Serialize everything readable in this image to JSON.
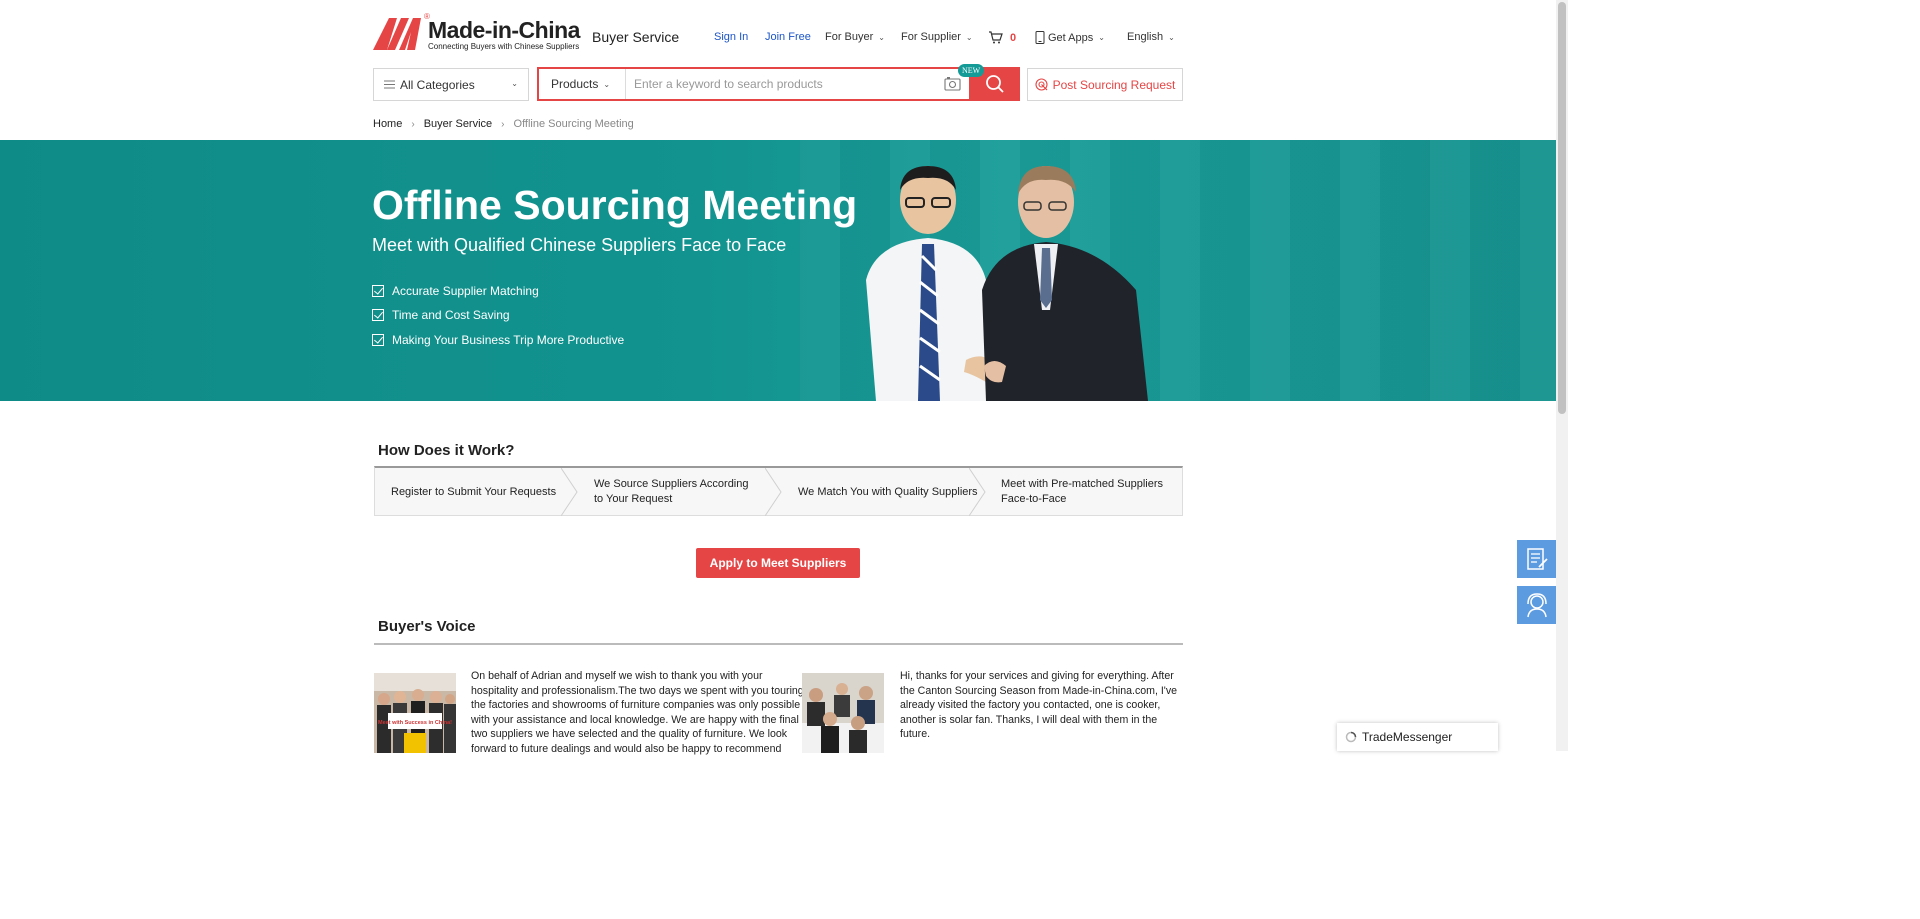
{
  "brand": {
    "name": "Made-in-China",
    "registered": "®",
    "tagline": "Connecting Buyers with Chinese Suppliers",
    "section": "Buyer Service",
    "color_primary": "#e64545",
    "color_teal": "#149a97"
  },
  "topnav": {
    "sign_in": "Sign In",
    "join_free": "Join Free",
    "for_buyer": "For Buyer",
    "for_supplier": "For Supplier",
    "cart_count": "0",
    "get_apps": "Get Apps",
    "language": "English"
  },
  "search": {
    "categories_label": "All Categories",
    "scope_label": "Products",
    "placeholder": "Enter a keyword to search products",
    "new_badge": "NEW",
    "post_request": "Post Sourcing Request"
  },
  "breadcrumb": [
    "Home",
    "Buyer Service",
    "Offline Sourcing Meeting"
  ],
  "banner": {
    "title": "Offline Sourcing Meeting",
    "subtitle": "Meet with Qualified Chinese Suppliers Face to Face",
    "features": [
      "Accurate Supplier Matching",
      "Time and Cost Saving",
      "Making Your Business Trip More Productive"
    ]
  },
  "how": {
    "title": "How Does it Work?",
    "steps": [
      {
        "line1": "Register to Submit Your Requests",
        "line2": ""
      },
      {
        "line1": "We Source Suppliers According",
        "line2": "to Your Request"
      },
      {
        "line1": "We Match You with Quality Suppliers",
        "line2": ""
      },
      {
        "line1": "Meet with Pre-matched Suppliers",
        "line2": "Face-to-Face"
      }
    ]
  },
  "apply_label": "Apply to Meet Suppliers",
  "voice": {
    "title": "Buyer's Voice",
    "photo_sign": "Meet with Success in China!",
    "items": [
      {
        "lines": [
          "On behalf of Adrian and myself we wish to thank you with your",
          "hospitality and professionalism.The two days we spent with you touring",
          "the factories and showrooms of furniture companies was only possible",
          "with your assistance and local knowledge. We are happy with the final",
          "two suppliers we have selected and the quality of furniture. We look",
          "forward to future dealings and would also be happy to recommend"
        ]
      },
      {
        "lines": [
          "Hi, thanks for your services and giving for everything. After",
          "the Canton Sourcing Season from Made-in-China.com, I've",
          "already visited the factory you contacted, one is cooker,",
          "another is solar fan. Thanks, I will deal with them in the",
          "future."
        ]
      }
    ]
  },
  "floating": {
    "inquiry_icon": "form-icon",
    "service_icon": "customer-service-icon",
    "trade_messenger": "TradeMessenger"
  }
}
